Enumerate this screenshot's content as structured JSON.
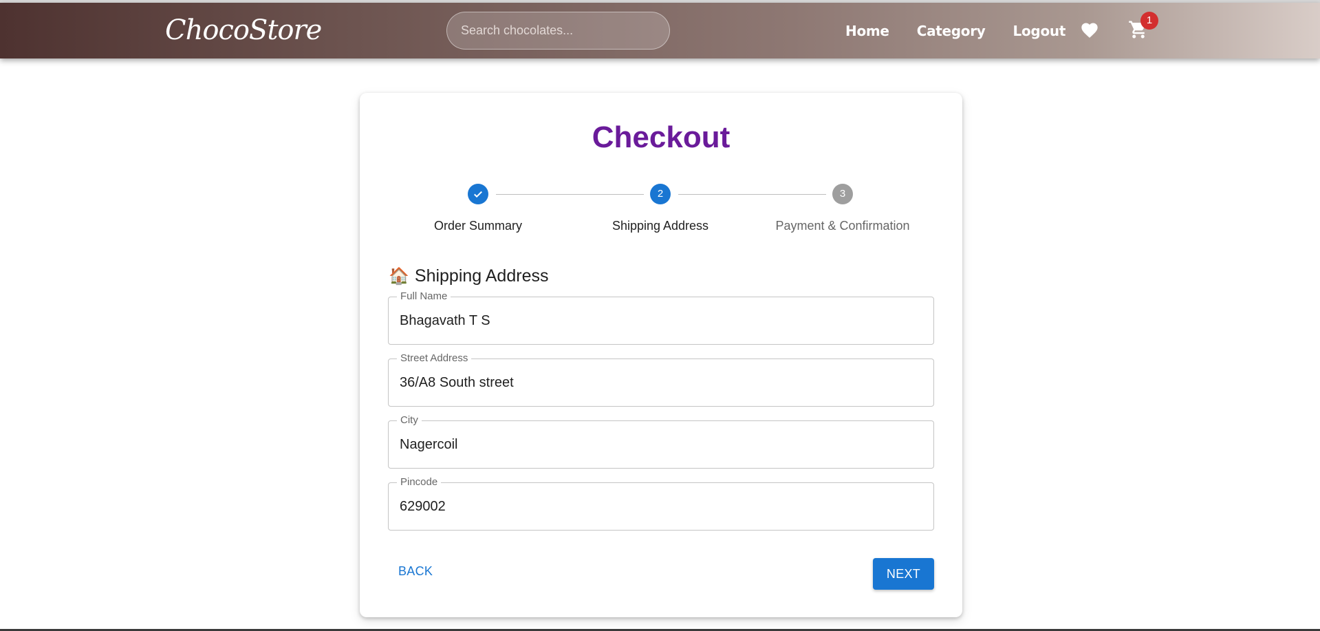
{
  "header": {
    "logo": "ChocoStore",
    "search_placeholder": "Search chocolates...",
    "nav": [
      "Home",
      "Category",
      "Logout"
    ],
    "cart_count": "1"
  },
  "checkout": {
    "title": "Checkout",
    "steps": [
      {
        "label": "Order Summary",
        "marker": "✓",
        "state": "completed"
      },
      {
        "label": "Shipping Address",
        "marker": "2",
        "state": "active"
      },
      {
        "label": "Payment & Confirmation",
        "marker": "3",
        "state": "pending"
      }
    ],
    "section_icon": "🏠",
    "section_title": "Shipping Address",
    "fields": [
      {
        "label": "Full Name",
        "value": "Bhagavath T S"
      },
      {
        "label": "Street Address",
        "value": "36/A8 South street"
      },
      {
        "label": "City",
        "value": "Nagercoil"
      },
      {
        "label": "Pincode",
        "value": "629002"
      }
    ],
    "back_label": "BACK",
    "next_label": "NEXT"
  },
  "colors": {
    "accent": "#1976d2",
    "title": "#6a1b9a",
    "pending": "#9e9e9e",
    "badge": "#d32f2f"
  },
  "icons": [
    "heart-icon",
    "cart-icon",
    "check-icon",
    "house-icon"
  ]
}
